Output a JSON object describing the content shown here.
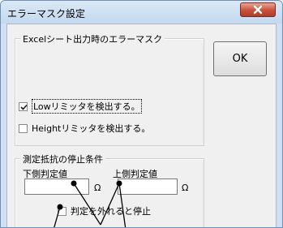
{
  "window": {
    "title": "エラーマスク設定"
  },
  "ok_button": {
    "label": "OK"
  },
  "mask_group": {
    "legend": "Excelシート出力時のエラーマスク",
    "low_check": {
      "label": "Lowリミッタを検出する。",
      "checked": true
    },
    "high_check": {
      "label": "Heightリミッタを検出する。",
      "checked": false
    }
  },
  "stop_group": {
    "legend": "測定抵抗の停止条件",
    "lower_label": "下側判定値",
    "upper_label": "上側判定値",
    "lower_value": "",
    "upper_value": "",
    "unit": "Ω",
    "out_check": {
      "label": "判定を外れると停止",
      "checked": false
    }
  },
  "colors": {
    "titlebar": "#cfe0f3",
    "close_button": "#c8503a",
    "dialog_bg": "#f0f0f0"
  }
}
